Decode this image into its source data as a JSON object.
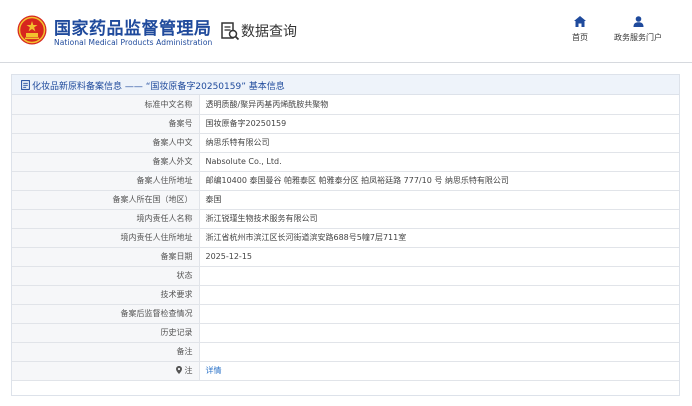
{
  "header": {
    "org_name_cn": "国家药品监督管理局",
    "org_name_en": "National Medical Products Administration",
    "section_title": "数据查询",
    "nav": [
      {
        "label": "首页",
        "icon": "home-icon"
      },
      {
        "label": "政务服务门户",
        "icon": "user-icon"
      }
    ]
  },
  "panel": {
    "title": "化妆品新原料备案信息 —— “国妆原备字20250159” 基本信息"
  },
  "rows": [
    {
      "label": "标准中文名称",
      "value": "透明质酸/聚异丙基丙烯酰胺共聚物"
    },
    {
      "label": "备案号",
      "value": "国妆原备字20250159"
    },
    {
      "label": "备案人中文",
      "value": "纳思乐特有限公司"
    },
    {
      "label": "备案人外文",
      "value": "Nabsolute Co., Ltd."
    },
    {
      "label": "备案人住所地址",
      "value": "邮编10400 泰国曼谷 帕雅泰区 帕雅泰分区 拍凤裕廷路 777/10 号 纳思乐特有限公司"
    },
    {
      "label": "备案人所在国（地区）",
      "value": "泰国"
    },
    {
      "label": "境内责任人名称",
      "value": "浙江锐瑾生物技术服务有限公司"
    },
    {
      "label": "境内责任人住所地址",
      "value": "浙江省杭州市滨江区长河街道滨安路688号5幢7层711室"
    },
    {
      "label": "备案日期",
      "value": "2025-12-15"
    },
    {
      "label": "状态",
      "value": ""
    },
    {
      "label": "技术要求",
      "value": ""
    },
    {
      "label": "备案后监督检查情况",
      "value": ""
    },
    {
      "label": "历史记录",
      "value": ""
    },
    {
      "label": "备注",
      "value": ""
    },
    {
      "label": "注",
      "value": "详情"
    }
  ],
  "colors": {
    "brand": "#1f4a9c",
    "link": "#2b73c8",
    "emblem_red": "#d7261e",
    "emblem_gold": "#f2c12e"
  }
}
